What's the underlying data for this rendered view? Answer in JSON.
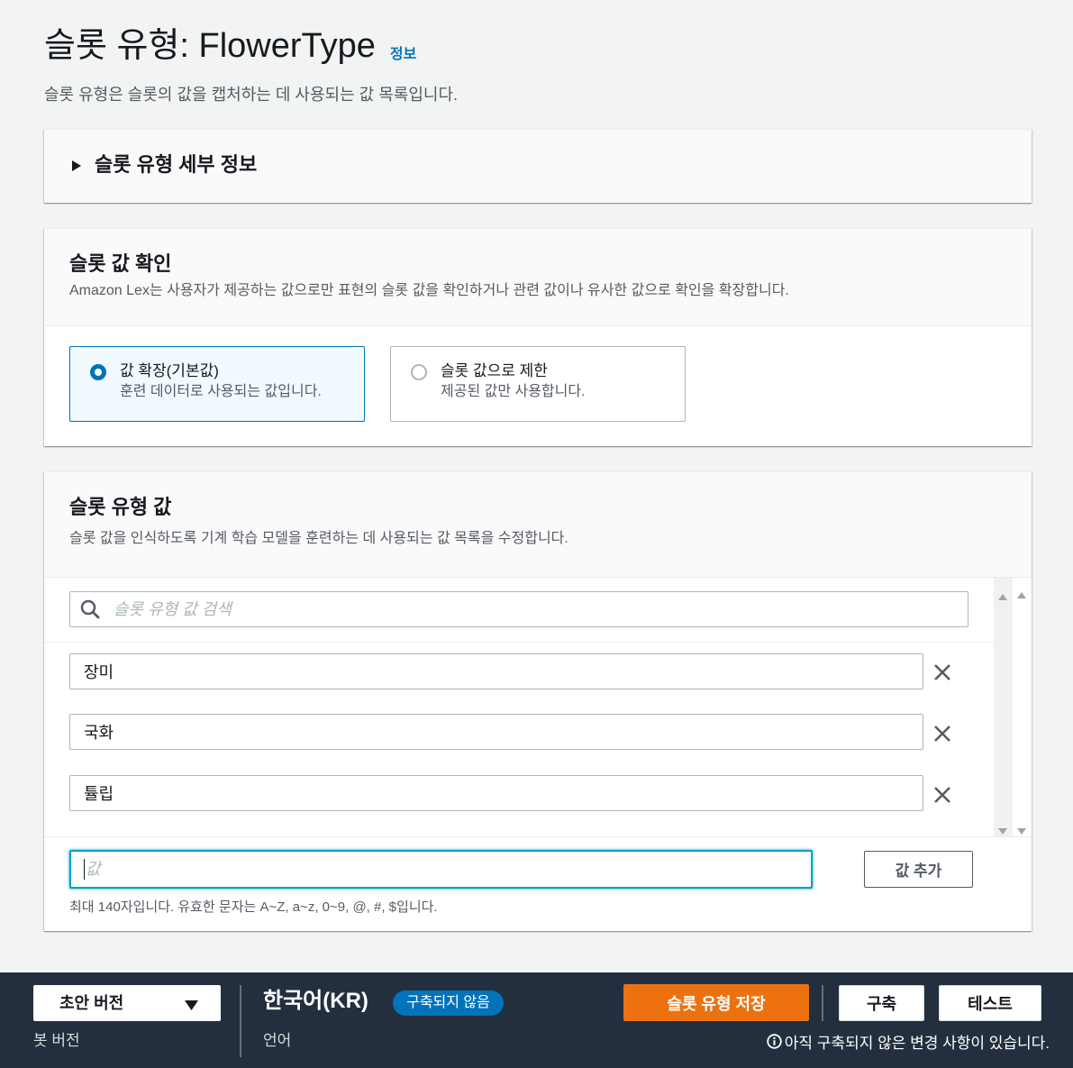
{
  "page": {
    "title": "슬롯 유형: FlowerType",
    "info_link": "정보",
    "description": "슬롯 유형은 슬롯의 값을 캡처하는 데 사용되는 값 목록입니다."
  },
  "details_panel": {
    "title": "슬롯 유형 세부 정보",
    "expanded": false
  },
  "resolution_panel": {
    "title": "슬롯 값 확인",
    "description": "Amazon Lex는 사용자가 제공하는 값으로만 표현의 슬롯 값을 확인하거나 관련 값이나 유사한 값으로 확인을 확장합니다.",
    "options": [
      {
        "label": "값 확장(기본값)",
        "description": "훈련 데이터로 사용되는 값입니다.",
        "selected": true
      },
      {
        "label": "슬롯 값으로 제한",
        "description": "제공된 값만 사용합니다.",
        "selected": false
      }
    ]
  },
  "values_panel": {
    "title": "슬롯 유형 값",
    "description": "슬롯 값을 인식하도록 기계 학습 모델을 훈련하는 데 사용되는 값 목록을 수정합니다.",
    "search_placeholder": "슬롯 유형 값 검색",
    "values": [
      "장미",
      "국화",
      "튤립"
    ],
    "new_value_placeholder": "값",
    "add_button": "값 추가",
    "constraint_hint": "최대 140자입니다. 유효한 문자는 A~Z, a~z, 0~9, @, #, $입니다."
  },
  "footer": {
    "version_select": "초안 버전",
    "version_label": "봇 버전",
    "language": "한국어(KR)",
    "build_status": "구축되지 않음",
    "language_label": "언어",
    "save_button": "슬롯 유형 저장",
    "build_button": "구축",
    "test_button": "테스트",
    "unsaved_notice": "아직 구축되지 않은 변경 사항이 있습니다."
  },
  "icons": {
    "details_toggle": "caret-right-icon",
    "search": "search-icon",
    "remove_value": "close-icon",
    "version_dropdown": "caret-down-icon",
    "notice": "info-icon"
  },
  "colors": {
    "accent": "#0073bb",
    "primary_button": "#ec7211",
    "footer_background": "#232f3e",
    "focus_ring": "#00a1c9",
    "status_badge": "#0073bb"
  }
}
